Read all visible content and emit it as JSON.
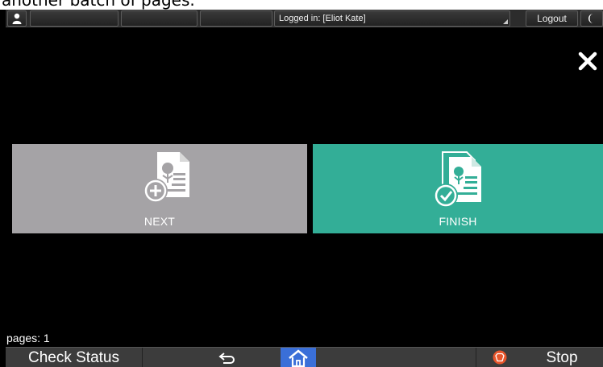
{
  "caption": "another batch of pages.",
  "statusbar": {
    "logged_in_text": "Logged in: [Eliot Kate]",
    "logout_label": "Logout",
    "user_icon": "user-icon",
    "moon_icon": "moon-icon"
  },
  "dialog": {
    "close_icon": "close-icon",
    "tiles": [
      {
        "label": "NEXT",
        "icon": "add-document-icon",
        "color": "#a5a3a6"
      },
      {
        "label": "FINISH",
        "icon": "document-check-icon",
        "color": "#33ae97"
      }
    ],
    "pages_text": "pages: 1"
  },
  "bottombar": {
    "check_status_label": "Check Status",
    "back_icon": "back-arrow-icon",
    "home_icon": "home-icon",
    "home_color": "#3a6fd8",
    "stop_icon": "stop-icon",
    "stop_label": "Stop"
  }
}
